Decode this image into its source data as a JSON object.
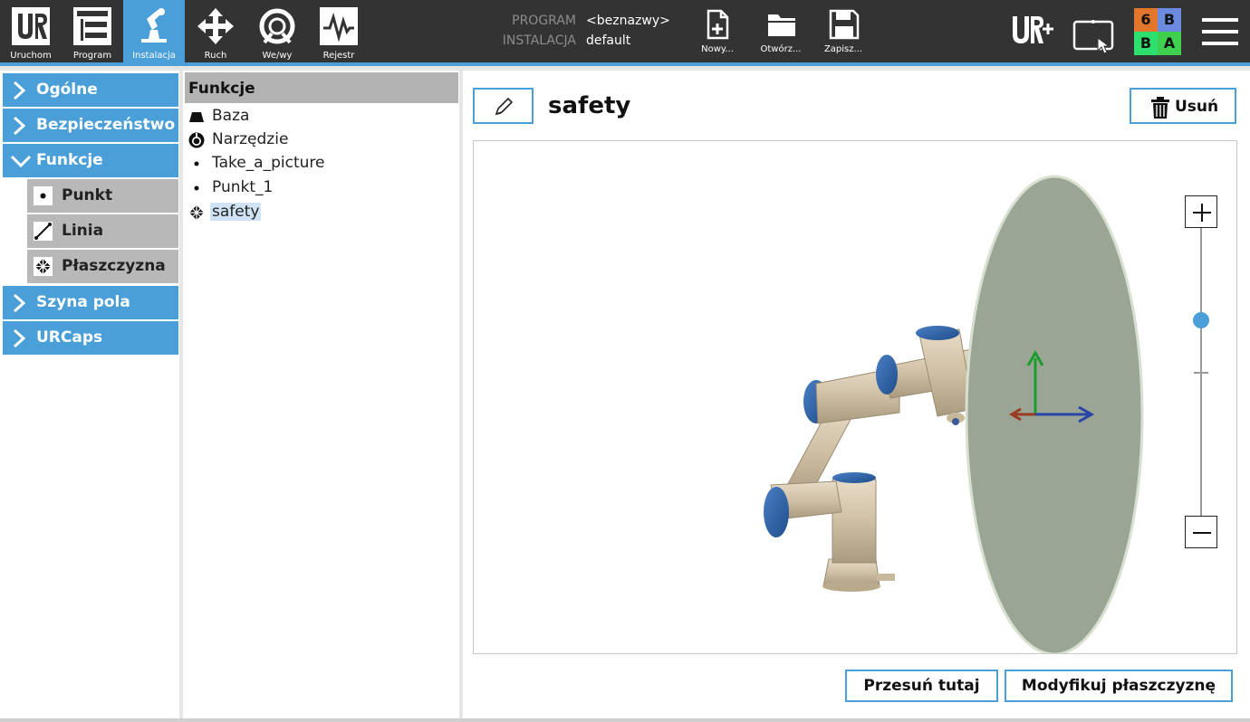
{
  "topbar": {
    "tabs": [
      {
        "label": "Uruchom",
        "icon": "ur-logo-icon"
      },
      {
        "label": "Program",
        "icon": "program-tree-icon"
      },
      {
        "label": "Instalacja",
        "icon": "robot-arm-icon",
        "active": true
      },
      {
        "label": "Ruch",
        "icon": "move-arrows-icon"
      },
      {
        "label": "We/wy",
        "icon": "io-icon"
      },
      {
        "label": "Rejestr",
        "icon": "log-icon"
      }
    ],
    "program_key": "PROGRAM",
    "program_value": "<beznazwy>",
    "installation_key": "INSTALACJA",
    "installation_value": "default",
    "file_buttons": [
      {
        "label": "Nowy...",
        "icon": "new-file-icon"
      },
      {
        "label": "Otwórz...",
        "icon": "folder-icon"
      },
      {
        "label": "Zapisz...",
        "icon": "save-icon"
      }
    ],
    "safety_badge": {
      "tl": "6",
      "tr": "B",
      "bl": "B",
      "br": "A"
    },
    "accent": "#4a9fd8"
  },
  "sidebar": {
    "items": [
      {
        "label": "Ogólne",
        "expanded": false
      },
      {
        "label": "Bezpieczeństwo",
        "expanded": false
      },
      {
        "label": "Funkcje",
        "expanded": true
      },
      {
        "label": "Szyna pola",
        "expanded": false
      },
      {
        "label": "URCaps",
        "expanded": false
      }
    ],
    "sub_items": [
      {
        "label": "Punkt",
        "icon": "point-icon"
      },
      {
        "label": "Linia",
        "icon": "line-icon"
      },
      {
        "label": "Płaszczyzna",
        "icon": "plane-icon"
      }
    ]
  },
  "tree": {
    "header": "Funkcje",
    "rows": [
      {
        "label": "Baza",
        "icon": "base-icon"
      },
      {
        "label": "Narzędzie",
        "icon": "tool-icon"
      },
      {
        "label": "Take_a_picture",
        "icon": "point-icon"
      },
      {
        "label": "Punkt_1",
        "icon": "point-icon"
      },
      {
        "label": "safety",
        "icon": "plane-icon",
        "selected": true
      }
    ]
  },
  "main": {
    "feature_name": "safety",
    "delete_label": "Usuń",
    "move_here_label": "Przesuń tutaj",
    "modify_plane_label": "Modyfikuj płaszczyznę",
    "zoom_level": 0.68
  }
}
